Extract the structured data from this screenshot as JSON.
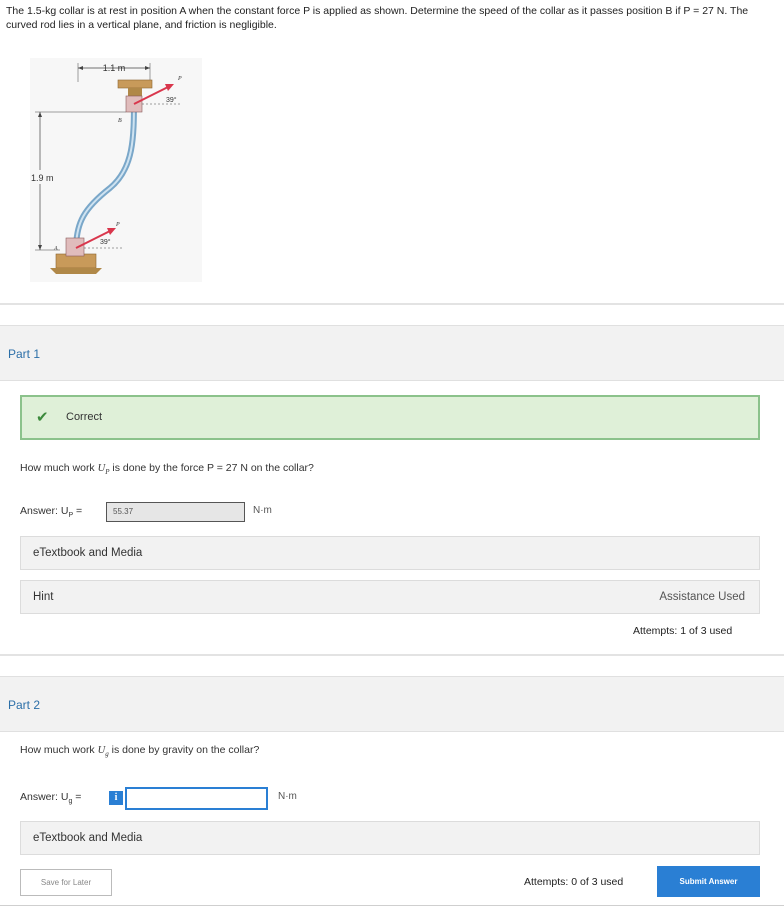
{
  "problem": {
    "text": "The 1.5-kg collar is at rest in position A when the constant force P is applied as shown. Determine the speed of the collar as it passes position B if P = 27 N. The curved rod lies in a vertical plane, and friction is negligible."
  },
  "figure": {
    "dim_horizontal": "1.1 m",
    "dim_vertical": "1.9 m",
    "angle_top": "39°",
    "angle_bottom": "39°",
    "label_P_top": "P",
    "label_P_bottom": "P",
    "label_A": "A",
    "label_B": "B"
  },
  "part1": {
    "title": "Part 1",
    "status": "Correct",
    "question_pre": "How much work ",
    "question_var": "U",
    "question_sub": "P",
    "question_post": " is done by the force P = 27 N on the collar?",
    "answer_label": "Answer: U",
    "answer_sub": "P",
    "answer_eq": " =",
    "answer_value": "55.37",
    "unit": "N·m",
    "etextbook": "eTextbook and Media",
    "hint": "Hint",
    "assistance": "Assistance Used",
    "attempts": "Attempts: 1 of 3 used"
  },
  "part2": {
    "title": "Part 2",
    "question_pre": "How much work ",
    "question_var": "U",
    "question_sub": "g",
    "question_post": " is done by gravity on the collar?",
    "answer_label": "Answer: U",
    "answer_sub": "g",
    "answer_eq": " =",
    "info_icon": "i",
    "answer_value": "",
    "unit": "N·m",
    "etextbook": "eTextbook and Media",
    "save_label": "Save for Later",
    "attempts": "Attempts: 0 of 3 used",
    "submit_label": "Submit Answer"
  },
  "colors": {
    "accent": "#2a7fd4",
    "success_bg": "#dff0d8",
    "success_border": "#8bc28b",
    "force_arrow": "#d9364c"
  }
}
